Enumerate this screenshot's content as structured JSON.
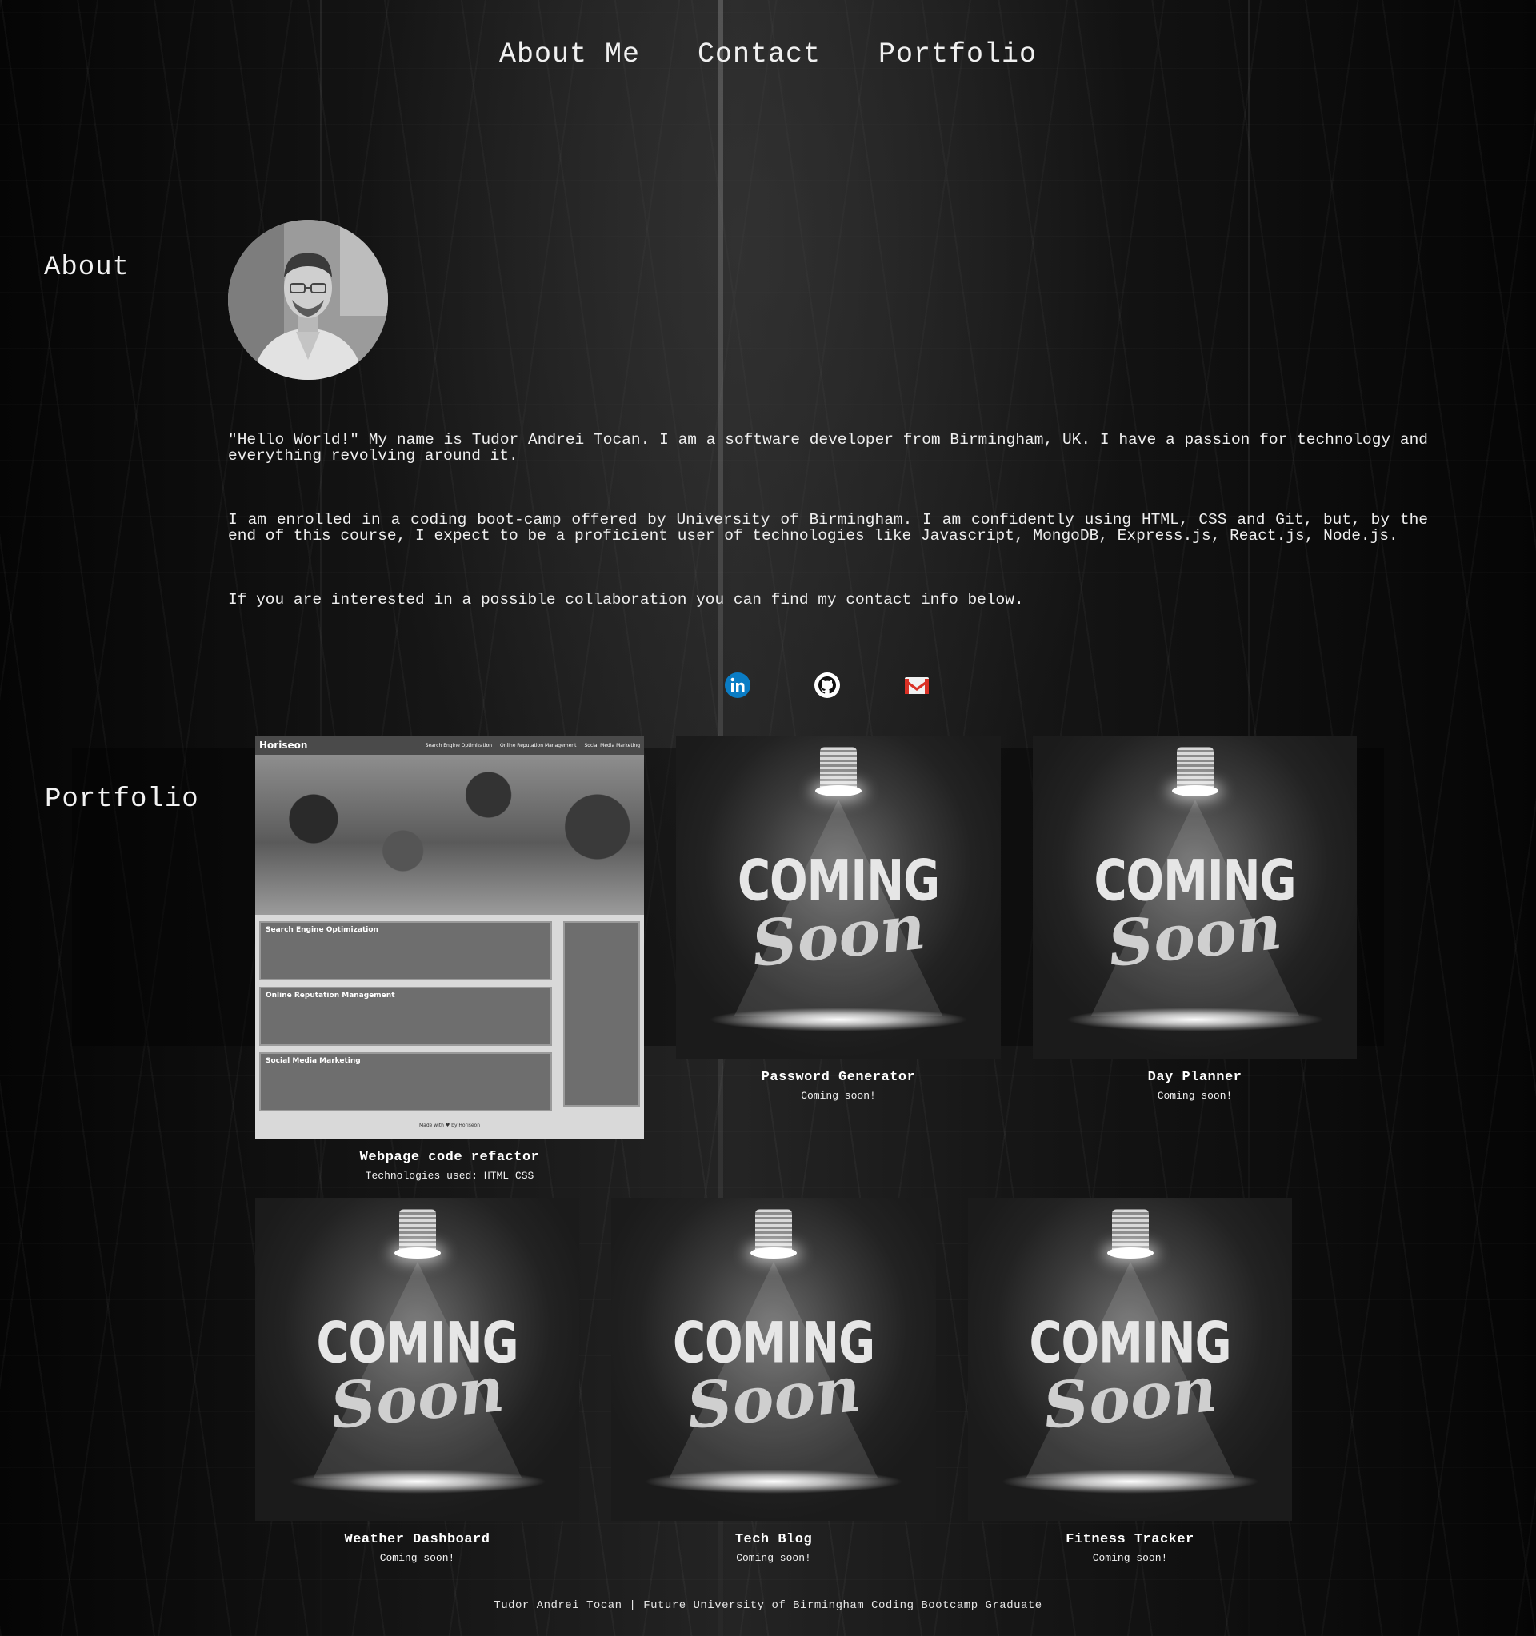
{
  "nav": {
    "items": [
      {
        "label": "About Me"
      },
      {
        "label": "Contact"
      },
      {
        "label": "Portfolio"
      }
    ]
  },
  "about": {
    "heading": "About",
    "paragraphs": [
      "\"Hello World!\" My name is Tudor Andrei Tocan. I am a software developer from Birmingham, UK. I have a passion for technology and everything revolving around it.",
      "I am enrolled in a coding boot-camp offered by University of Birmingham. I am confidently using HTML, CSS and Git, but, by the end of this course, I expect to be a proficient user of technologies like Javascript, MongoDB, Express.js, React.js, Node.js.",
      "If you are interested in a possible collaboration you can find my contact info below."
    ],
    "socials": [
      {
        "icon": "linkedin-icon",
        "label": "in",
        "color": "#0a7cc4"
      },
      {
        "icon": "github-icon",
        "color": "#ffffff"
      },
      {
        "icon": "gmail-icon",
        "color": "#d93025"
      }
    ]
  },
  "portfolio": {
    "heading": "Portfolio",
    "projects": [
      {
        "title": "Webpage code refactor",
        "subtitle": "Technologies used: HTML CSS",
        "image": "horiseon-screenshot",
        "mock": {
          "brand": "Horiseon",
          "links": [
            "Search Engine Optimization",
            "Online Reputation Management",
            "Social Media Marketing"
          ],
          "boxes": [
            "Search Engine Optimization",
            "Online Reputation Management",
            "Social Media Marketing"
          ],
          "footer": "Made with ♥ by Horiseon"
        }
      },
      {
        "title": "Password Generator",
        "subtitle": "Coming soon!",
        "image": "coming-soon"
      },
      {
        "title": "Day Planner",
        "subtitle": "Coming soon!",
        "image": "coming-soon"
      },
      {
        "title": "Weather Dashboard",
        "subtitle": "Coming soon!",
        "image": "coming-soon"
      },
      {
        "title": "Tech Blog",
        "subtitle": "Coming soon!",
        "image": "coming-soon"
      },
      {
        "title": "Fitness Tracker",
        "subtitle": "Coming soon!",
        "image": "coming-soon"
      }
    ],
    "coming_soon": {
      "line1": "COMING",
      "line2": "Soon"
    }
  },
  "footer": {
    "text": "Tudor Andrei Tocan | Future University of Birmingham Coding Bootcamp Graduate"
  }
}
